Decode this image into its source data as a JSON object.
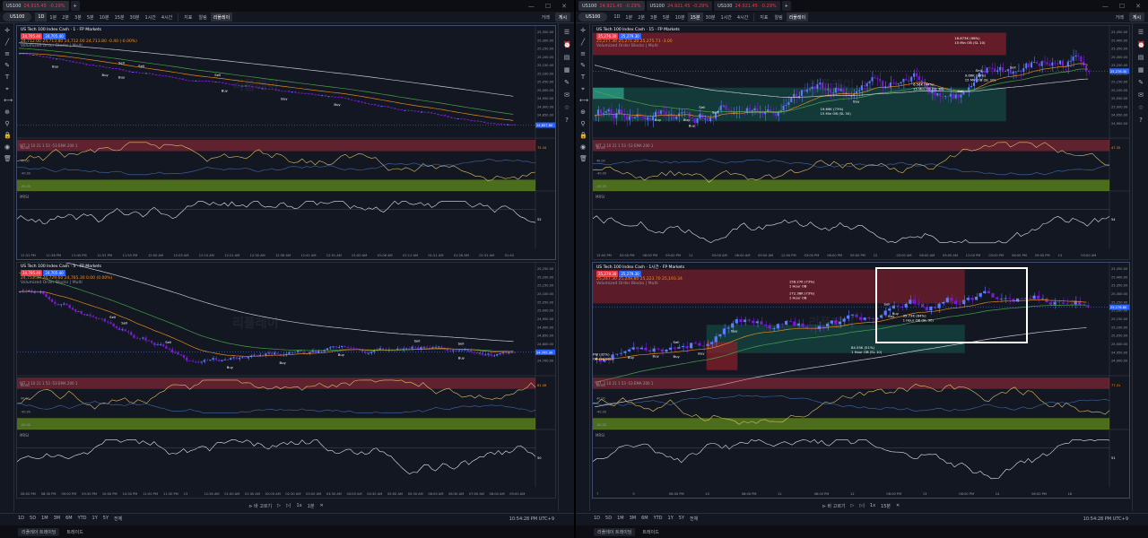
{
  "left": {
    "tabs": [
      {
        "sym": "US100",
        "price": "24,915.45",
        "chg": "-0.29%"
      },
      {
        "sym": "",
        "price": "",
        "chg": ""
      }
    ],
    "symbol": "US100",
    "timeframes": [
      "1D",
      "1분",
      "2분",
      "3분",
      "5분",
      "10분",
      "15분",
      "30분",
      "1시간",
      "4시간"
    ],
    "selected_tf": "1D",
    "toolbar": {
      "indicator": "지표",
      "alert": "알림",
      "replay": "리플레이",
      "trade": "거래",
      "publish": "게시"
    },
    "charts": [
      {
        "title": "US Tech 100 Index Cash · 1 · FP Markets",
        "o": "24,705.40",
        "c": "24,705.40",
        "ohlc": "24,712.00  24,713.80  24,712.00  24,713.80  -0.40 (-0.00%)",
        "sub": "Volumized Order Blocks | Multi",
        "last": "24,857.80",
        "sub1": "WT_3 10 21 1 53 -53 EMA 200 1",
        "sub1v": "75.34",
        "sub2": "MRSI",
        "sub2v": "52",
        "times": [
          "11:31 PM",
          "11:36 PM",
          "11:45 PM",
          "11:51 PM",
          "11:55 PM",
          "12:00 AM",
          "12:05 AM",
          "12:10 AM",
          "12:21 AM",
          "12:30 AM",
          "12:36 AM",
          "12:41 AM",
          "12:51 AM",
          "01:00 AM",
          "01:06 AM",
          "01:11 AM",
          "01:21 AM",
          "01:26 AM",
          "01:31 AM",
          "01:40"
        ],
        "yticks": [
          "25,350.00",
          "25,300.00",
          "25,250.00",
          "25,200.00",
          "25,150.00",
          "25,100.00",
          "25,050.00",
          "25,000.00",
          "24,950.00",
          "24,900.00",
          "24,850.00",
          "24,800.00"
        ]
      },
      {
        "title": "US Tech 100 Index Cash · 5 · FP Markets",
        "o": "24,705.40",
        "c": "24,705.40",
        "ohlc": "24,753.39  24,729.60  24,765.30  0.00 (0.00%)",
        "sub": "Volumized Order Blocks | Multi",
        "last": "24,705.30",
        "sub1": "WT_3 10 21 1 53 -53 EMA 200 1",
        "sub1v": "61.08",
        "sub2": "MRSI",
        "sub2v": "50",
        "times": [
          "08:00 PM",
          "08:30 PM",
          "09:00 PM",
          "09:30 PM",
          "10:00 PM",
          "10:30 PM",
          "11:00 PM",
          "11:30 PM",
          "13",
          "12:30 AM",
          "01:00 AM",
          "01:30 AM",
          "02:00 AM",
          "02:30 AM",
          "03:00 AM",
          "03:30 AM",
          "04:00 AM",
          "04:30 AM",
          "05:00 AM",
          "05:30 AM",
          "06:00 AM",
          "06:30 AM",
          "07:00 AM",
          "08:00 AM",
          "09:00 AM"
        ],
        "yticks": [
          "25,250.00",
          "25,200.00",
          "25,150.00",
          "25,100.00",
          "25,050.00",
          "25,000.00",
          "24,950.00",
          "24,900.00",
          "24,850.00",
          "24,800.00",
          "24,750.00",
          "24,700.00"
        ]
      }
    ],
    "bottom": {
      "goto": "바 고르기",
      "speed": "1x",
      "skip": "1분"
    },
    "status_ranges": [
      "1D",
      "5D",
      "1M",
      "3M",
      "6M",
      "YTD",
      "1Y",
      "5Y",
      "전체"
    ],
    "clock": "10:54:28 PM UTC+9",
    "footer": [
      "리플레이 트레이딩",
      "트레이드"
    ]
  },
  "right": {
    "tabs": [
      {
        "sym": "US100",
        "price": "24,921.45",
        "chg": "-0.29%"
      },
      {
        "sym": "US100",
        "price": "24,921.45",
        "chg": "-0.29%"
      },
      {
        "sym": "US100",
        "price": "24,921.45",
        "chg": "-0.29%"
      }
    ],
    "symbol": "US100",
    "timeframes": [
      "1D",
      "1분",
      "2분",
      "3분",
      "5분",
      "10분",
      "15분",
      "30분",
      "1시간",
      "4시간"
    ],
    "selected_tf": "15분",
    "toolbar": {
      "indicator": "지표",
      "alert": "알림",
      "replay": "리플레이",
      "trade": "거래",
      "publish": "게시"
    },
    "charts": [
      {
        "title": "US Tech 100 Index Cash · 15 · FP Markets",
        "o": "25,276.30",
        "c": "25,279.30",
        "ohlc": "25,277.30  25,271.20  25,275.71  -3.00",
        "sub": "Volumized Order Blocks | Multi",
        "last": "25,276.30",
        "sub1": "WT_3 10 21 1 53 -53 EMA 200 1",
        "sub1v": "47.35",
        "sub2": "MRSI",
        "sub2v": "54",
        "times": [
          "12:00 PM",
          "02:00 PM",
          "06:00 PM",
          "09:00 PM",
          "11",
          "03:00 AM",
          "06:00 AM",
          "09:00 AM",
          "12:00 PM",
          "03:00 PM",
          "06:00 PM",
          "09:00 PM",
          "12",
          "03:00 AM",
          "06:00 AM",
          "09:00 AM",
          "12:00 PM",
          "03:00 PM",
          "06:00 PM",
          "09:00 PM",
          "13",
          "03:00 AM"
        ],
        "yticks": [
          "25,450.00",
          "25,400.00",
          "25,350.00",
          "25,300.00",
          "25,250.00",
          "25,200.00",
          "25,150.00",
          "25,100.00",
          "25,050.00",
          "25,000.00",
          "24,950.00",
          "24,900.00"
        ],
        "labels": [
          "18.873K (98%)",
          "15 Min OB (SL 10)",
          "9.66K (99%)",
          "15 Min OB (SL 10)",
          "6.56K (44%)",
          "15 Min OB (SL 30)",
          "19.69K (73%)",
          "15 Min OB (SL 30)"
        ]
      },
      {
        "title": "US Tech 100 Index Cash · 1시간 · FP Markets",
        "o": "25,279.30",
        "c": "25,279.30",
        "ohlc": "25,247.30  25,249.80  25,223.70  25,193.34",
        "sub": "Volumized Order Blocks | Multi",
        "last": "25,176.80",
        "sub1": "WT_3 10 21 1 53 -53 EMA 200 1",
        "sub1v": "77.31",
        "sub2": "MRSI",
        "sub2v": "51",
        "times": [
          "7",
          "9",
          "06:00 PM",
          "10",
          "06:00 PM",
          "11",
          "06:00 PM",
          "12",
          "06:00 PM",
          "13",
          "06:00 PM",
          "14",
          "06:00 PM",
          "16"
        ],
        "yticks": [
          "25,450.00",
          "25,400.00",
          "25,350.00",
          "25,300.00",
          "25,250.00",
          "25,200.00",
          "25,150.00",
          "25,100.00",
          "25,050.00",
          "25,000.00",
          "24,950.00",
          "24,900.00"
        ],
        "labels": [
          "158.27K (73%)",
          "1 Hour OB",
          "172.38K (73%)",
          "1 Hour OB",
          "84.55K (51%)",
          "1 Hour OB (SL 10)",
          "FW (32%)",
          "OB (SL 10)",
          "35.73K (84%)",
          "1 Hour OB (SL 30)"
        ]
      }
    ],
    "bottom": {
      "goto": "바 고르기",
      "speed": "1x",
      "skip": "15분"
    },
    "status_ranges": [
      "1D",
      "5D",
      "1M",
      "3M",
      "6M",
      "YTD",
      "1Y",
      "5Y",
      "전체"
    ],
    "clock": "10:54:28 PM UTC+9",
    "footer": [
      "리플레이 트레이딩",
      "트레이드"
    ]
  },
  "watermark": "리플레이",
  "signals": {
    "buy": "Buy",
    "sell": "Sell"
  },
  "colors": {
    "bg": "#131722",
    "up": "#5b7cff",
    "down": "#7a1bd6",
    "red_zone": "#f23645",
    "green_zone": "#7cb518",
    "ema_orange": "#f7931a",
    "ema_green": "#4caf50",
    "ema_white": "#d9d9e6"
  },
  "icons": [
    "crosshair-icon",
    "trendline-icon",
    "fib-icon",
    "brush-icon",
    "text-icon",
    "pattern-icon",
    "ruler-icon",
    "zoom-icon",
    "magnet-icon",
    "lock-icon",
    "eye-icon",
    "trash-icon"
  ]
}
